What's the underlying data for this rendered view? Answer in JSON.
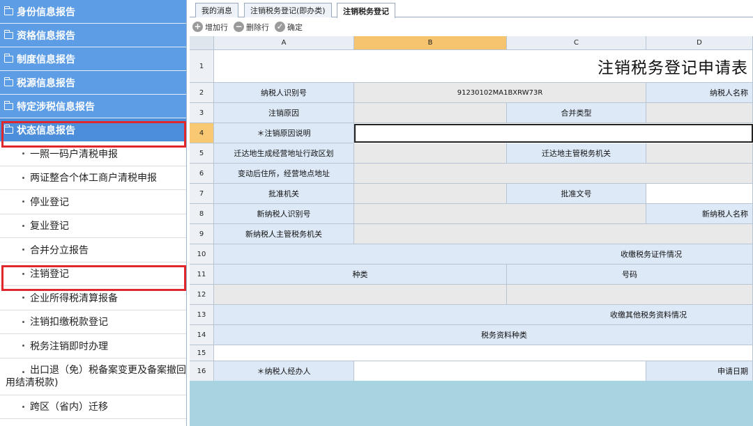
{
  "sidebar": {
    "categories": [
      "身份信息报告",
      "资格信息报告",
      "制度信息报告",
      "税源信息报告",
      "特定涉税信息报告",
      "状态信息报告"
    ],
    "items": [
      "一照一码户清税申报",
      "两证整合个体工商户清税申报",
      "停业登记",
      "复业登记",
      "合并分立报告",
      "注销登记",
      "企业所得税清算报备",
      "注销扣缴税款登记",
      "税务注销即时办理",
      "出口退（免）税备案变更及备案撤回",
      "用结清税款)",
      "跨区（省内）迁移"
    ]
  },
  "tabs": [
    "我的消息",
    "注销税务登记(即办类)",
    "注销税务登记"
  ],
  "toolbar": {
    "add": "增加行",
    "delete": "删除行",
    "confirm": "确定"
  },
  "columns": [
    "A",
    "B",
    "C",
    "D"
  ],
  "rows": [
    "1",
    "2",
    "3",
    "4",
    "5",
    "6",
    "7",
    "8",
    "9",
    "10",
    "11",
    "12",
    "13",
    "14",
    "15",
    "16"
  ],
  "form": {
    "title": "注销税务登记申请表",
    "taxpayer_id_label": "纳税人识别号",
    "taxpayer_id_value": "91230102MA1BXRW73R",
    "taxpayer_name_label": "纳税人名称",
    "cancel_reason_label": "注销原因",
    "merge_type_label": "合并类型",
    "cancel_reason_desc_label": "＊注销原因说明",
    "region_label": "迁达地生成经营地址行政区划",
    "tax_authority_label": "迁达地主管税务机关",
    "new_address_label": "变动后住所，经营地点地址",
    "approval_org_label": "批准机关",
    "approval_doc_label": "批准文号",
    "new_id_label": "新纳税人识别号",
    "new_name_label": "新纳税人名称",
    "new_authority_label": "新纳税人主管税务机关",
    "cert_section": "收缴税务证件情况",
    "type_label": "种类",
    "number_label": "号码",
    "other_section": "收缴其他税务资料情况",
    "material_type_label": "税务资料种类",
    "handler_label": "＊纳税人经办人",
    "apply_date_label": "申请日期"
  }
}
